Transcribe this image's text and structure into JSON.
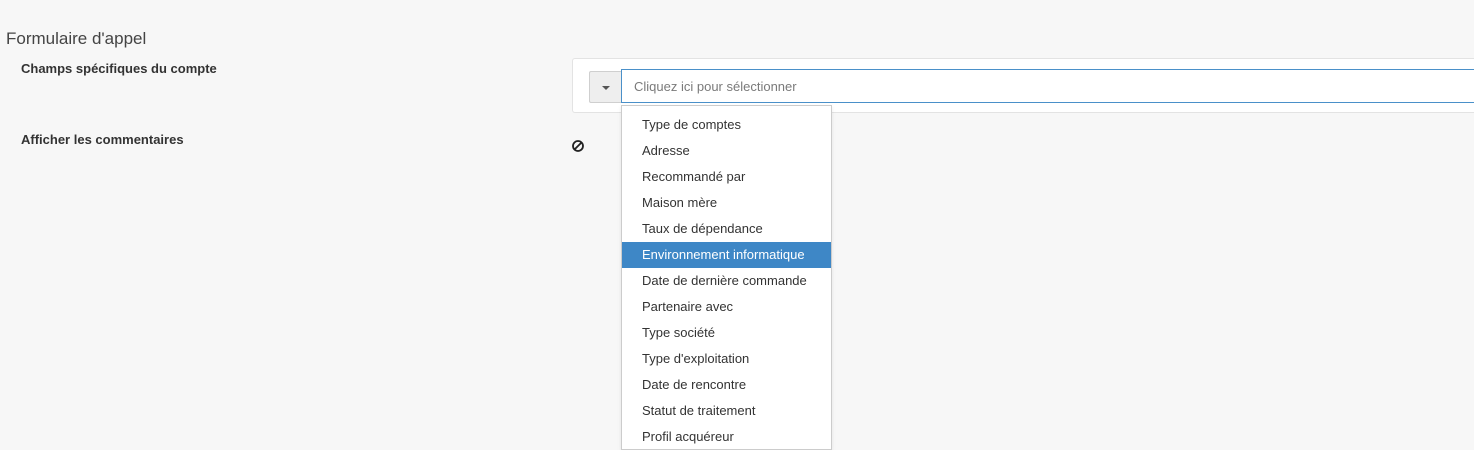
{
  "section": {
    "title": "Formulaire d'appel"
  },
  "fields": {
    "account_specific": {
      "label": "Champs spécifiques du compte",
      "placeholder": "Cliquez ici pour sélectionner",
      "toggle_icon": "caret-down-icon"
    },
    "show_comments": {
      "label": "Afficher les commentaires",
      "value_icon": "ban-icon"
    }
  },
  "dropdown": {
    "selected_index": 5,
    "options": [
      "Type de comptes",
      "Adresse",
      "Recommandé par",
      "Maison mère",
      "Taux de dépendance",
      "Environnement informatique",
      "Date de dernière commande",
      "Partenaire avec",
      "Type société",
      "Type d'exploitation",
      "Date de rencontre",
      "Statut de traitement",
      "Profil acquéreur"
    ]
  },
  "colors": {
    "accent": "#3e87c6",
    "input_focus_border": "#4a90c9",
    "page_background": "#f7f7f7"
  }
}
